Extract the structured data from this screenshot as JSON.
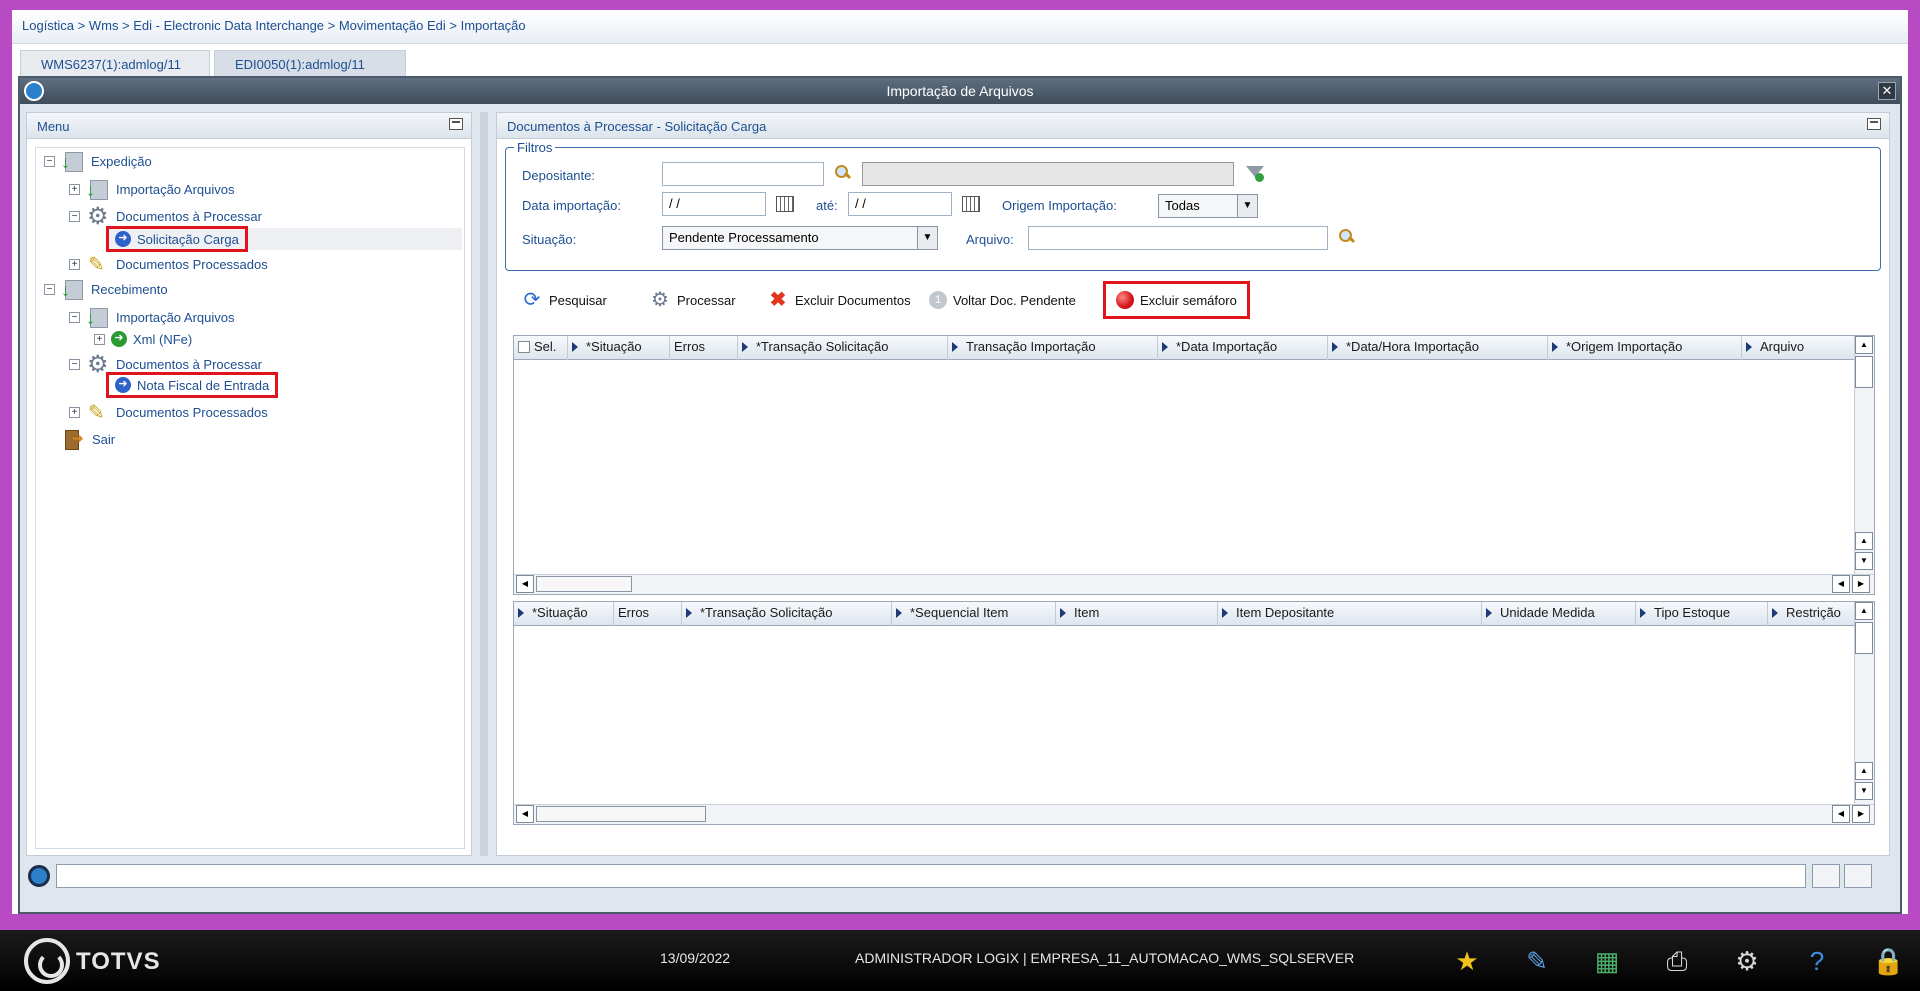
{
  "breadcrumb": "Logística > Wms > Edi - Electronic Data Interchange > Movimentação Edi > Importação",
  "tabs": [
    {
      "label": "WMS6237(1):admlog/11"
    },
    {
      "label": "EDI0050(1):admlog/11"
    }
  ],
  "window": {
    "title": "Importação de Arquivos",
    "close": "✕"
  },
  "menu": {
    "title": "Menu",
    "tree": [
      {
        "label": "Expedição",
        "expander": "−"
      },
      {
        "label": "Importação Arquivos",
        "expander": "+"
      },
      {
        "label": "Documentos à Processar",
        "expander": "−"
      },
      {
        "label": "Solicitação Carga"
      },
      {
        "label": "Documentos Processados",
        "expander": "+"
      },
      {
        "label": "Recebimento",
        "expander": "−"
      },
      {
        "label": "Importação Arquivos",
        "expander": "−"
      },
      {
        "label": "Xml (NFe)",
        "expander": "+"
      },
      {
        "label": "Documentos à Processar",
        "expander": "−"
      },
      {
        "label": "Nota Fiscal de Entrada"
      },
      {
        "label": "Documentos Processados",
        "expander": "+"
      },
      {
        "label": "Sair"
      }
    ]
  },
  "main": {
    "title": "Documentos à Processar - Solicitação Carga",
    "filters": {
      "legend": "Filtros",
      "depositante_label": "Depositante:",
      "depositante_value": "",
      "depositante_desc": "",
      "data_label": "Data importação:",
      "data_from": "  /  /",
      "ate_label": "até:",
      "data_to": "  /  /",
      "origem_label": "Origem Importação:",
      "origem_value": "Todas",
      "situacao_label": "Situação:",
      "situacao_value": "Pendente Processamento",
      "arquivo_label": "Arquivo:",
      "arquivo_value": ""
    },
    "toolbar": {
      "pesquisar": "Pesquisar",
      "processar": "Processar",
      "excluir_documentos": "Excluir Documentos",
      "voltar": "Voltar Doc. Pendente",
      "voltar_icon_num": "1",
      "excluir_semaforo": "Excluir semáforo"
    },
    "grid1_headers": [
      "Sel.",
      "*Situação",
      "Erros",
      "*Transação Solicitação",
      "Transação Importação",
      "*Data Importação",
      "*Data/Hora Importação",
      "*Origem Importação",
      "Arquivo"
    ],
    "grid2_headers": [
      "*Situação",
      "Erros",
      "*Transação Solicitação",
      "*Sequencial Item",
      "Item",
      "Item Depositante",
      "Unidade Medida",
      "Tipo Estoque",
      "Restrição"
    ]
  },
  "taskbar": {
    "brand": "TOTVS",
    "date": "13/09/2022",
    "user": "ADMINISTRADOR LOGIX | EMPRESA_11_AUTOMACAO_WMS_SQLSERVER"
  },
  "colors": {
    "highlight": "#e0141c",
    "link": "#1d4f91",
    "frame": "#b84bc4"
  }
}
